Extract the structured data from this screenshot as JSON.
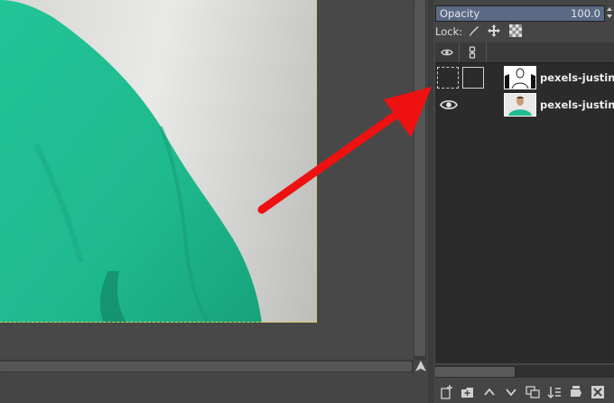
{
  "layers_panel": {
    "opacity_label": "Opacity",
    "opacity_value": "100.0",
    "opacity_fraction": 1.0,
    "lock_label": "Lock:",
    "layers": [
      {
        "name": "pexels-justin",
        "visible": false,
        "thumbnail": "mask-thumbnail"
      },
      {
        "name": "pexels-justin",
        "visible": true,
        "thumbnail": "photo-thumbnail"
      }
    ],
    "toolbar_icons": [
      "new-layer-icon",
      "new-layer-group-icon",
      "raise-layer-icon",
      "lower-layer-icon",
      "duplicate-layer-icon",
      "merge-down-icon",
      "add-mask-icon",
      "delete-layer-icon"
    ]
  },
  "colors": {
    "annotation_arrow": "#ee1111",
    "shirt": "#1fb98e",
    "canvas_boundary": "#e0d24a"
  }
}
